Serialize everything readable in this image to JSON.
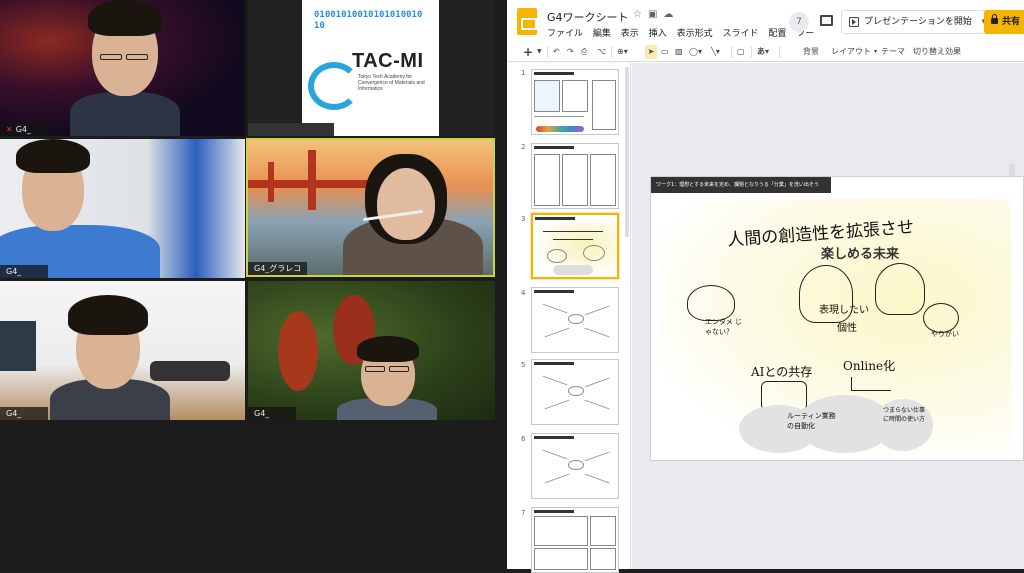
{
  "conference": {
    "participants": [
      {
        "name": "G4_",
        "muted": true
      },
      {
        "name": ""
      },
      {
        "name": "G4_"
      },
      {
        "name": "G4_グラレコ"
      },
      {
        "name": "G4_"
      },
      {
        "name": "G4_"
      }
    ],
    "logo": {
      "binary": "0100101001010101001010",
      "brand": "TAC-MI",
      "tagline": "Tokyo Tech Academy for Convergence of Materials and Informatics"
    }
  },
  "slides_app": {
    "doc_title": "G4ワークシート",
    "menu": [
      "ファイル",
      "編集",
      "表示",
      "挿入",
      "表示形式",
      "スライド",
      "配置",
      "ツー"
    ],
    "comment_count": "7",
    "present_label": "プレゼンテーションを開始",
    "share_label": "共有",
    "toolbar": {
      "new_slide": "+",
      "background": "背景",
      "layout": "レイアウト",
      "theme": "テーマ",
      "transition": "切り替え効果"
    },
    "slide_numbers": [
      "1",
      "2",
      "3",
      "4",
      "5",
      "6",
      "7"
    ],
    "active_slide": 3,
    "current_slide": {
      "title": "ワーク1：理想とする未来を定め、課題となりうる「分業」を洗い出そう",
      "sketch_text": {
        "headline": "人間の創造性を拡張させ",
        "headline2": "楽しめる未来",
        "emotion": "エンタメ じゃない？",
        "expression": "表現したい",
        "individuality": "個性",
        "ai": "AIとの共存",
        "online": "Online化",
        "routine": "ルーティン業務の自動化",
        "free_time": "つまらない仕事に時間の使い方",
        "work": "やりがい"
      }
    }
  }
}
